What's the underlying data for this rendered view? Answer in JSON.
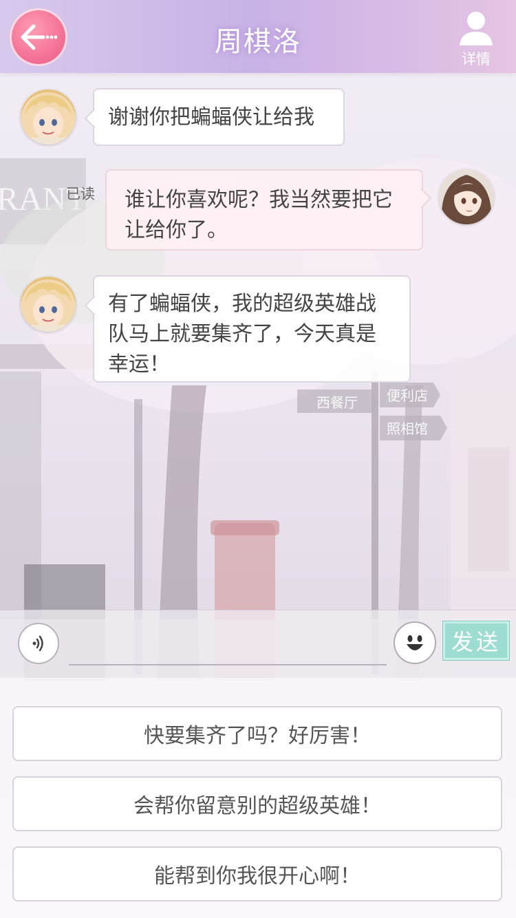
{
  "header": {
    "title": "周棋洛",
    "detail_label": "详情"
  },
  "messages": [
    {
      "sender": "contact",
      "text_lines": [
        "谢谢你把蝙蝠侠让给我"
      ]
    },
    {
      "sender": "self",
      "read_status": "已读",
      "text_lines": [
        "谁让你喜欢呢？我当然要把它",
        "让给你了。"
      ]
    },
    {
      "sender": "contact",
      "text_lines": [
        "有了蝙蝠侠，我的超级英雄战",
        "队马上就要集齐了，今天真是",
        "幸运！"
      ]
    }
  ],
  "input_bar": {
    "text_value": "",
    "send_label": "发送"
  },
  "options": [
    {
      "label": "快要集齐了吗？好厉害！"
    },
    {
      "label": "会帮你留意别的超级英雄！"
    },
    {
      "label": "能帮到你我很开心啊！"
    }
  ],
  "background_signs": [
    "西餐厅",
    "便利店",
    "照相馆"
  ],
  "colors": {
    "header_gradient_start": "#d7c9ec",
    "header_gradient_end": "#e6c4e4",
    "back_button": "#f47396",
    "send_button": "#9cdcd1",
    "self_bubble": "#fef0f3"
  }
}
